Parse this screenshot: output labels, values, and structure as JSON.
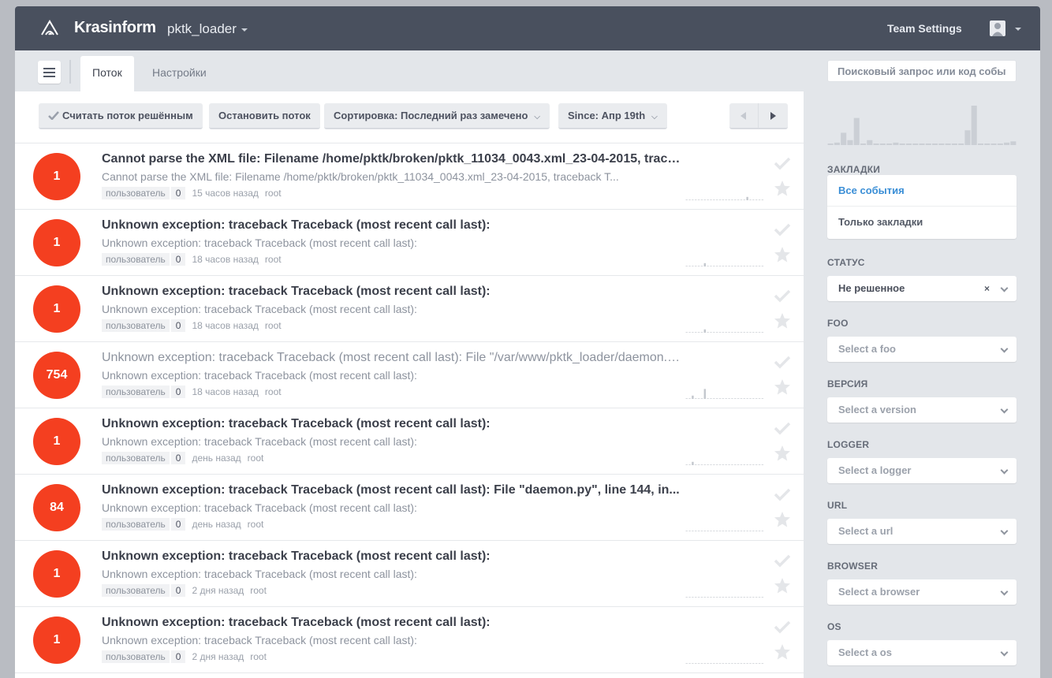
{
  "header": {
    "brand": "Krasinform",
    "project": "pktk_loader",
    "team_settings": "Team Settings"
  },
  "subbar": {
    "tabs": [
      {
        "label": "Поток"
      },
      {
        "label": "Настройки"
      }
    ],
    "search_placeholder": "Поисковый запрос или код события"
  },
  "toolbar": {
    "resolve": "Считать поток решённым",
    "stop": "Остановить поток",
    "sort": "Сортировка: Последний раз замечено",
    "since": "Since: Апр 19th"
  },
  "events": [
    {
      "count": "1",
      "title": "Cannot parse the XML file: Filename /home/pktk/broken/pktk_11034_0043.xml_23-04-2015, traceback T...",
      "desc": "Cannot parse the XML file: Filename /home/pktk/broken/pktk_11034_0043.xml_23-04-2015, traceback T...",
      "user": "пользователь",
      "users_count": "0",
      "when": "15 часов назад",
      "logger": "root",
      "muted": false,
      "spark": [
        0,
        0,
        0,
        0,
        0,
        0,
        0,
        0,
        0,
        0,
        0,
        0,
        0,
        0,
        0,
        0,
        0,
        0,
        0,
        0,
        3,
        0,
        0,
        0,
        0,
        0
      ]
    },
    {
      "count": "1",
      "title": "Unknown exception: traceback Traceback (most recent call last):",
      "desc": "Unknown exception: traceback Traceback (most recent call last):",
      "user": "пользователь",
      "users_count": "0",
      "when": "18 часов назад",
      "logger": "root",
      "muted": false,
      "spark": [
        0,
        0,
        0,
        0,
        0,
        0,
        3,
        0,
        0,
        0,
        0,
        0,
        0,
        0,
        0,
        0,
        0,
        0,
        0,
        0,
        0,
        0,
        0,
        0,
        0,
        0
      ]
    },
    {
      "count": "1",
      "title": "Unknown exception: traceback Traceback (most recent call last):",
      "desc": "Unknown exception: traceback Traceback (most recent call last):",
      "user": "пользователь",
      "users_count": "0",
      "when": "18 часов назад",
      "logger": "root",
      "muted": false,
      "spark": [
        0,
        0,
        0,
        0,
        0,
        0,
        3,
        0,
        0,
        0,
        0,
        0,
        0,
        0,
        0,
        0,
        0,
        0,
        0,
        0,
        0,
        0,
        0,
        0,
        0,
        0
      ]
    },
    {
      "count": "754",
      "title": "Unknown exception: traceback Traceback (most recent call last): File \"/var/www/pktk_loader/daemon.py\"...",
      "desc": "Unknown exception: traceback Traceback (most recent call last):",
      "user": "пользователь",
      "users_count": "0",
      "when": "18 часов назад",
      "logger": "root",
      "muted": true,
      "spark": [
        0,
        0,
        3,
        0,
        0,
        0,
        9,
        0,
        0,
        0,
        0,
        0,
        0,
        0,
        0,
        0,
        0,
        0,
        0,
        0,
        0,
        0,
        0,
        0,
        0,
        0
      ]
    },
    {
      "count": "1",
      "title": "Unknown exception: traceback Traceback (most recent call last):",
      "desc": "Unknown exception: traceback Traceback (most recent call last):",
      "user": "пользователь",
      "users_count": "0",
      "when": "день назад",
      "logger": "root",
      "muted": false,
      "spark": [
        0,
        0,
        3,
        0,
        0,
        0,
        0,
        0,
        0,
        0,
        0,
        0,
        0,
        0,
        0,
        0,
        0,
        0,
        0,
        0,
        0,
        0,
        0,
        0,
        0,
        0
      ]
    },
    {
      "count": "84",
      "title": "Unknown exception: traceback Traceback (most recent call last): File \"daemon.py\", line 144, in...",
      "desc": "Unknown exception: traceback Traceback (most recent call last):",
      "user": "пользователь",
      "users_count": "0",
      "when": "день назад",
      "logger": "root",
      "muted": false,
      "spark": [
        0,
        0,
        0,
        0,
        0,
        0,
        0,
        0,
        0,
        0,
        0,
        0,
        0,
        0,
        0,
        0,
        0,
        0,
        0,
        0,
        0,
        0,
        0,
        0,
        0,
        0
      ]
    },
    {
      "count": "1",
      "title": "Unknown exception: traceback Traceback (most recent call last):",
      "desc": "Unknown exception: traceback Traceback (most recent call last):",
      "user": "пользователь",
      "users_count": "0",
      "when": "2 дня назад",
      "logger": "root",
      "muted": false,
      "spark": [
        0,
        0,
        0,
        0,
        0,
        0,
        0,
        0,
        0,
        0,
        0,
        0,
        0,
        0,
        0,
        0,
        0,
        0,
        0,
        0,
        0,
        0,
        0,
        0,
        0,
        0
      ]
    },
    {
      "count": "1",
      "title": "Unknown exception: traceback Traceback (most recent call last):",
      "desc": "Unknown exception: traceback Traceback (most recent call last):",
      "user": "пользователь",
      "users_count": "0",
      "when": "2 дня назад",
      "logger": "root",
      "muted": false,
      "spark": [
        0,
        0,
        0,
        0,
        0,
        0,
        0,
        0,
        0,
        0,
        0,
        0,
        0,
        0,
        0,
        0,
        0,
        0,
        0,
        0,
        0,
        0,
        0,
        0,
        0,
        0
      ]
    }
  ],
  "sidebar": {
    "mini_chart": [
      1,
      2,
      10,
      4,
      22,
      1,
      4,
      1,
      1,
      1,
      2,
      1,
      1,
      1,
      1,
      1,
      1,
      1,
      1,
      1,
      1,
      12,
      32,
      1,
      1,
      1,
      1,
      2,
      3
    ],
    "bookmarks_label": "ЗАКЛАДКИ",
    "bookmarks": [
      {
        "label": "Все события"
      },
      {
        "label": "Только закладки"
      }
    ],
    "filters": [
      {
        "label": "СТАТУС",
        "value": "Не решенное",
        "filled": true
      },
      {
        "label": "FOO",
        "value": "Select a foo",
        "filled": false
      },
      {
        "label": "ВЕРСИЯ",
        "value": "Select a version",
        "filled": false
      },
      {
        "label": "LOGGER",
        "value": "Select a logger",
        "filled": false
      },
      {
        "label": "URL",
        "value": "Select a url",
        "filled": false
      },
      {
        "label": "BROWSER",
        "value": "Select a browser",
        "filled": false
      },
      {
        "label": "OS",
        "value": "Select a os",
        "filled": false
      }
    ],
    "clear_glyph": "×"
  },
  "colors": {
    "header_bg": "#49505e",
    "count_badge": "#f43f20",
    "accent_link": "#3a8ed6"
  }
}
